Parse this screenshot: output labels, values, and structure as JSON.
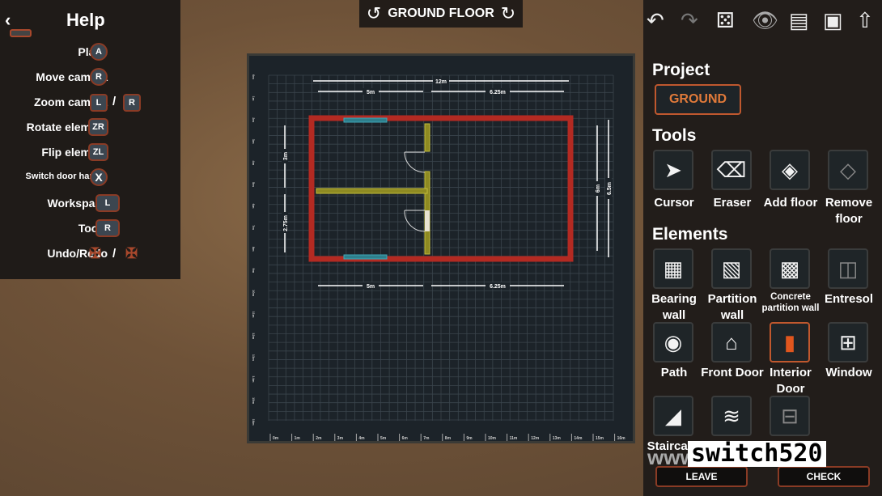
{
  "help": {
    "title": "Help",
    "back_icon": "chevron-left-icon",
    "rows": [
      {
        "label": "Place",
        "buttons": [
          "A"
        ]
      },
      {
        "label": "Move camera",
        "buttons": [
          "R"
        ]
      },
      {
        "label": "Zoom camera",
        "buttons": [
          "L",
          "R"
        ],
        "separator": "/"
      },
      {
        "label": "Rotate element",
        "buttons": [
          "ZR"
        ]
      },
      {
        "label": "Flip element",
        "buttons": [
          "ZL"
        ]
      },
      {
        "label": "Switch door handle",
        "buttons": [
          "X"
        ]
      },
      {
        "label": "Workspace",
        "buttons": [
          "L"
        ]
      },
      {
        "label": "Tools",
        "buttons": [
          "R"
        ]
      },
      {
        "label": "Undo/Redo",
        "buttons": [
          "dpad-left",
          "dpad-right"
        ],
        "separator": "/"
      }
    ]
  },
  "floor_bar": {
    "label": "GROUND FLOOR"
  },
  "plan": {
    "dims": {
      "total_width": "12m",
      "top_left": "5m",
      "top_right": "6.25m",
      "bottom_left": "5m",
      "bottom_right": "6.25m",
      "left_upper": "3m",
      "left_lower": "2.75m",
      "right_inner": "6m",
      "right_outer": "6.5m"
    },
    "colors": {
      "bearing_wall": "#b32a22",
      "partition_wall": "#a6a02a",
      "window": "#3fa7b8",
      "grid": "#3a444c",
      "board": "#1c2329"
    },
    "ruler_labels": [
      "0m",
      "1m",
      "2m",
      "3m",
      "4m",
      "5m",
      "6m",
      "7m",
      "8m",
      "9m",
      "10m",
      "11m",
      "12m",
      "13m",
      "14m",
      "15m",
      "16m"
    ]
  },
  "toolbar": {
    "icons": [
      "undo-icon",
      "redo-icon",
      "dice-icon",
      "eye-icon",
      "document-icon",
      "save-icon",
      "upload-icon"
    ]
  },
  "project": {
    "heading": "Project",
    "floor_button": "GROUND"
  },
  "tools": {
    "heading": "Tools",
    "items": [
      {
        "label": "Cursor",
        "icon": "cursor-icon"
      },
      {
        "label": "Eraser",
        "icon": "eraser-icon"
      },
      {
        "label": "Add floor",
        "icon": "add-floor-icon"
      },
      {
        "label": "Remove floor",
        "icon": "remove-floor-icon"
      }
    ]
  },
  "elements": {
    "heading": "Elements",
    "items": [
      {
        "label": "Bearing wall",
        "icon": "brick-wall-icon"
      },
      {
        "label": "Partition wall",
        "icon": "partition-wall-icon"
      },
      {
        "label": "Concrete partition wall",
        "icon": "concrete-wall-icon"
      },
      {
        "label": "Entresol",
        "icon": "entresol-icon"
      },
      {
        "label": "Path",
        "icon": "stone-path-icon"
      },
      {
        "label": "Front Door",
        "icon": "front-door-icon"
      },
      {
        "label": "Interior Door",
        "icon": "interior-door-icon",
        "selected": true
      },
      {
        "label": "Window",
        "icon": "window-icon"
      },
      {
        "label": "Staircase",
        "icon": "staircase-icon"
      },
      {
        "label": "",
        "icon": "pool-ladder-icon"
      },
      {
        "label": "",
        "icon": "balcony-icon"
      }
    ]
  },
  "actions": {
    "leave": "LEAVE",
    "check": "CHECK"
  },
  "watermark": {
    "text": "switch520",
    "prefix": "www"
  }
}
